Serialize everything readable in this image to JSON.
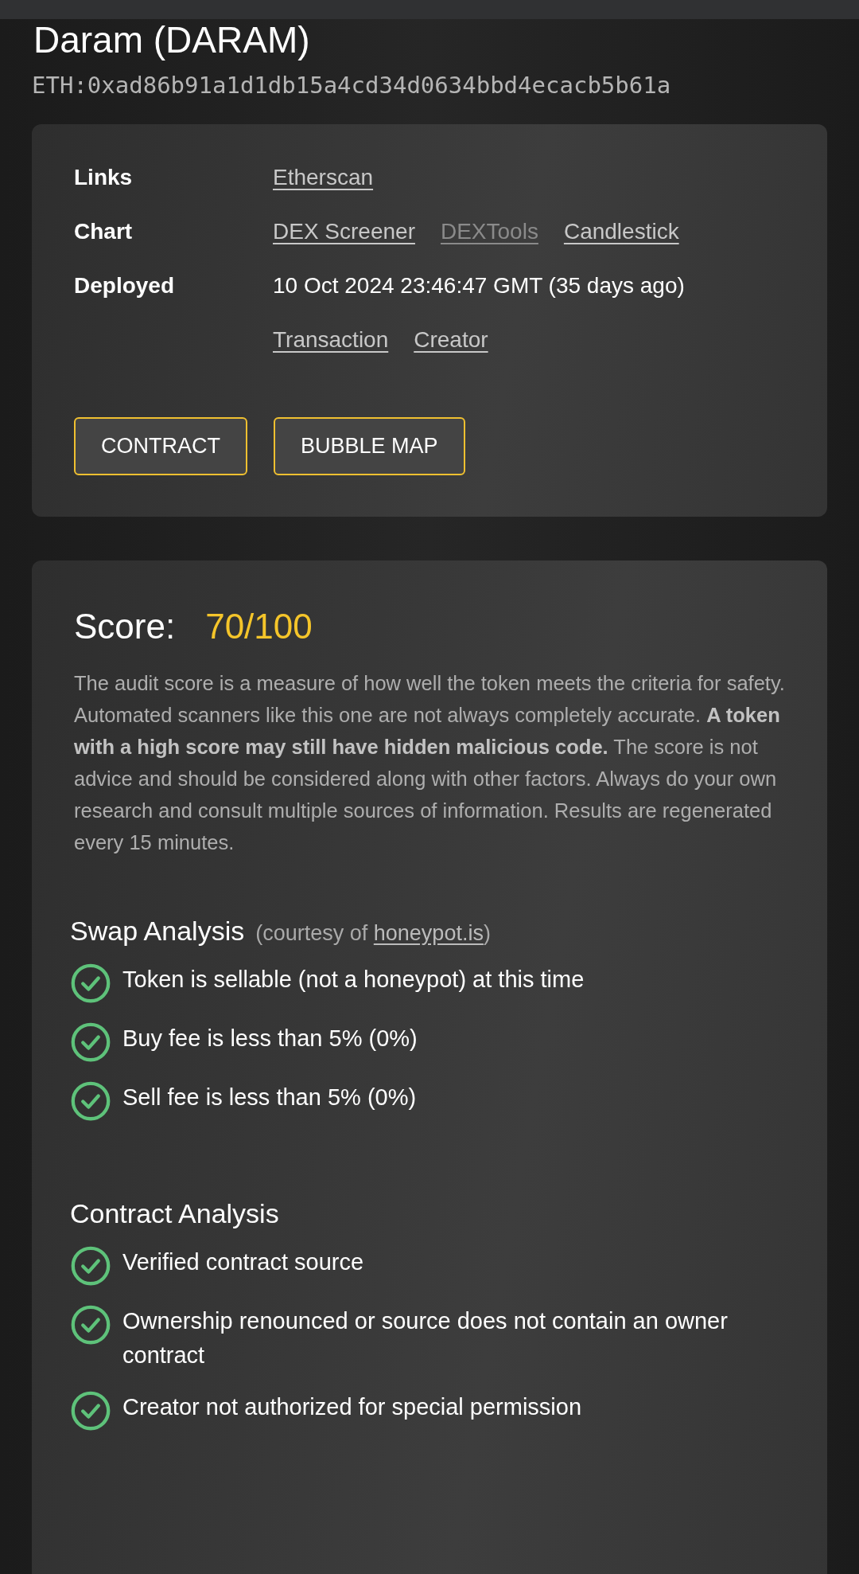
{
  "token": {
    "title": "Daram (DARAM)",
    "address": "ETH:0xad86b91a1d1db15a4cd34d0634bbd4ecacb5b61a"
  },
  "info": {
    "rows": [
      {
        "label": "Links",
        "links": [
          {
            "text": "Etherscan",
            "disabled": false
          }
        ]
      },
      {
        "label": "Chart",
        "links": [
          {
            "text": "DEX Screener",
            "disabled": false
          },
          {
            "text": "DEXTools",
            "disabled": true
          },
          {
            "text": "Candlestick",
            "disabled": false
          }
        ]
      },
      {
        "label": "Deployed",
        "value": "10 Oct 2024 23:46:47 GMT (35 days ago)",
        "links": [
          {
            "text": "Transaction",
            "disabled": false
          },
          {
            "text": "Creator",
            "disabled": false
          }
        ]
      }
    ],
    "buttons": [
      "CONTRACT",
      "BUBBLE MAP"
    ]
  },
  "score": {
    "label": "Score:",
    "value": "70/100",
    "description": "The audit score is a measure of how well the token meets the criteria for safety. Automated scanners like this one are not always completely accurate. **A token with a high score may still have hidden malicious code.** The score is not advice and should be considered along with other factors. Always do your own research and consult multiple sources of information. Results are regenerated every 15 minutes.",
    "sections": [
      {
        "title": "Swap Analysis",
        "note_before": "(courtesy of ",
        "note_link": "honeypot.is",
        "note_after": ")",
        "items": [
          {
            "text": "Token is sellable (not a honeypot) at this time",
            "passed": true
          },
          {
            "text": "Buy fee is less than 5% (0%)",
            "passed": true
          },
          {
            "text": "Sell fee is less than 5% (0%)",
            "passed": true
          }
        ]
      },
      {
        "title": "Contract Analysis",
        "items": [
          {
            "text": "Verified contract source",
            "passed": true
          },
          {
            "text": "Ownership renounced or source does not contain an owner contract",
            "passed": true
          },
          {
            "text": "Creator not authorized for special permission",
            "passed": true
          }
        ]
      }
    ]
  }
}
